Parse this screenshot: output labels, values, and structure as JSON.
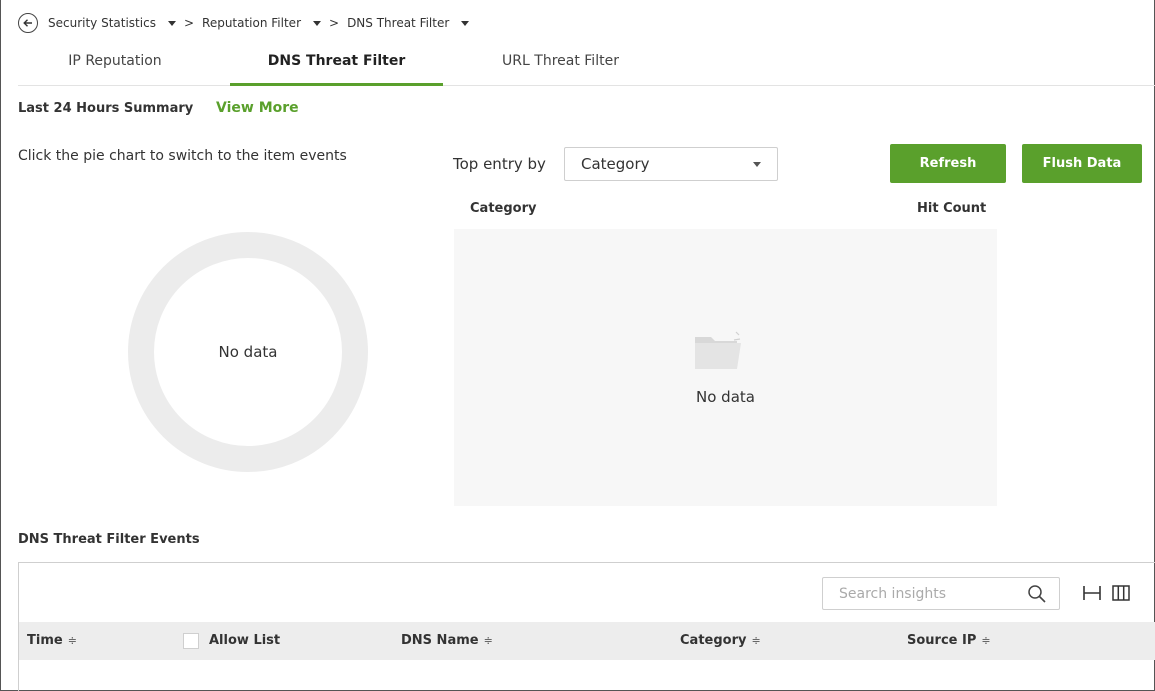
{
  "breadcrumb": {
    "items": [
      "Security Statistics",
      "Reputation Filter",
      "DNS Threat Filter"
    ],
    "separator": ">"
  },
  "tabs": [
    {
      "label": "IP Reputation",
      "active": false
    },
    {
      "label": "DNS Threat Filter",
      "active": true
    },
    {
      "label": "URL Threat Filter",
      "active": false
    }
  ],
  "summary": {
    "title": "Last 24 Hours Summary",
    "view_more": "View More",
    "hint": "Click the pie chart to switch to the item events",
    "pie_empty": "No data"
  },
  "top_entry": {
    "label": "Top entry by",
    "selected": "Category"
  },
  "buttons": {
    "refresh": "Refresh",
    "flush": "Flush Data"
  },
  "top_table": {
    "columns": [
      "Category",
      "Hit Count"
    ],
    "empty": "No data"
  },
  "events": {
    "title": "DNS Threat Filter Events",
    "search_placeholder": "Search insights",
    "columns": [
      "Time",
      "Allow List",
      "DNS Name",
      "Category",
      "Source IP"
    ],
    "sort_glyph": "≑"
  },
  "colors": {
    "accent": "#5aa02c",
    "panel_bg": "#f7f7f7",
    "header_bg": "#ededed"
  }
}
